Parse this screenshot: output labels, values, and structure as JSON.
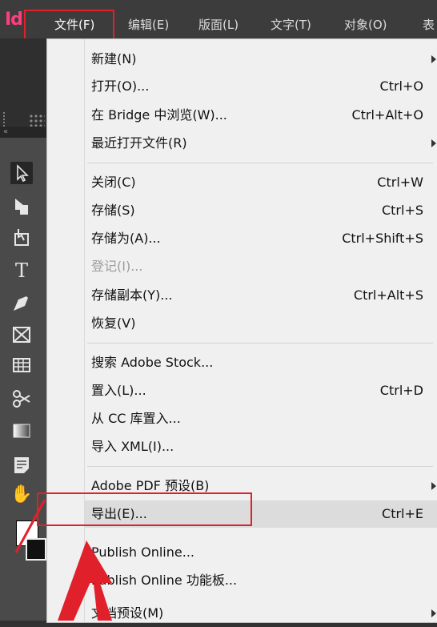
{
  "menubar": {
    "logo": "Id",
    "items": [
      {
        "label": "文件(F)"
      },
      {
        "label": "编辑(E)"
      },
      {
        "label": "版面(L)"
      },
      {
        "label": "文字(T)"
      },
      {
        "label": "对象(O)"
      },
      {
        "label": "表"
      }
    ]
  },
  "file_menu": {
    "groups": [
      [
        {
          "label": "新建(N)",
          "shortcut": "",
          "submenu": true
        },
        {
          "label": "打开(O)...",
          "shortcut": "Ctrl+O"
        },
        {
          "label": "在 Bridge 中浏览(W)...",
          "shortcut": "Ctrl+Alt+O"
        },
        {
          "label": "最近打开文件(R)",
          "shortcut": "",
          "submenu": true
        }
      ],
      [
        {
          "label": "关闭(C)",
          "shortcut": "Ctrl+W"
        },
        {
          "label": "存储(S)",
          "shortcut": "Ctrl+S"
        },
        {
          "label": "存储为(A)...",
          "shortcut": "Ctrl+Shift+S"
        },
        {
          "label": "登记(I)...",
          "shortcut": "",
          "disabled": true
        },
        {
          "label": "存储副本(Y)...",
          "shortcut": "Ctrl+Alt+S"
        },
        {
          "label": "恢复(V)",
          "shortcut": ""
        }
      ],
      [
        {
          "label": "搜索 Adobe Stock...",
          "shortcut": ""
        },
        {
          "label": "置入(L)...",
          "shortcut": "Ctrl+D"
        },
        {
          "label": "从 CC 库置入...",
          "shortcut": ""
        },
        {
          "label": "导入 XML(I)...",
          "shortcut": ""
        }
      ],
      [
        {
          "label": "Adobe PDF 预设(B)",
          "shortcut": "",
          "submenu": true
        },
        {
          "label": "导出(E)...",
          "shortcut": "Ctrl+E",
          "highlighted": true
        },
        {
          "label": "Publish Online...",
          "shortcut": ""
        },
        {
          "label": "Publish Online 功能板...",
          "shortcut": ""
        },
        {
          "label": "文档预设(M)",
          "shortcut": "",
          "submenu": true
        }
      ]
    ]
  },
  "tools": {
    "icons": [
      "selection-tool",
      "direct-selection-tool",
      "page-tool",
      "type-tool",
      "pen-tool",
      "rectangle-frame-tool",
      "table-tool",
      "scissors-tool",
      "gradient-tool",
      "note-tool",
      "hand-tool"
    ]
  },
  "colors": {
    "menubar_bg": "#3c3c3c",
    "menu_bg": "#f0f0f0",
    "highlight_border": "#e0202a",
    "annotation_arrow": "#e0202a"
  }
}
